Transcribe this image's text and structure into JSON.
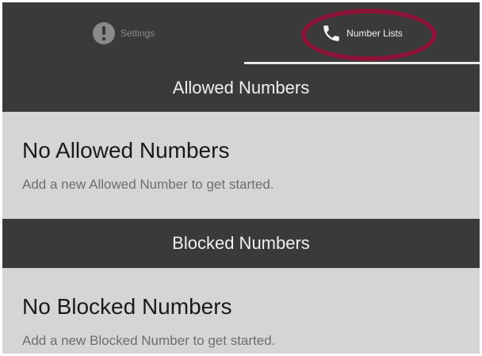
{
  "tabs": {
    "settings": {
      "label": "Settings",
      "icon": "alert-circle-icon",
      "active": false
    },
    "number_lists": {
      "label": "Number Lists",
      "icon": "phone-icon",
      "active": true
    }
  },
  "colors": {
    "tab_bar": "#3a3a3a",
    "panel": "#d5d5d5",
    "highlight_ring": "#8b1538",
    "active_indicator": "#e8e8e8"
  },
  "allowed": {
    "header": "Allowed Numbers",
    "empty_title": "No Allowed Numbers",
    "empty_subtitle": "Add a new Allowed Number to get started."
  },
  "blocked": {
    "header": "Blocked Numbers",
    "empty_title": "No Blocked Numbers",
    "empty_subtitle": "Add a new Blocked Number to get started."
  }
}
